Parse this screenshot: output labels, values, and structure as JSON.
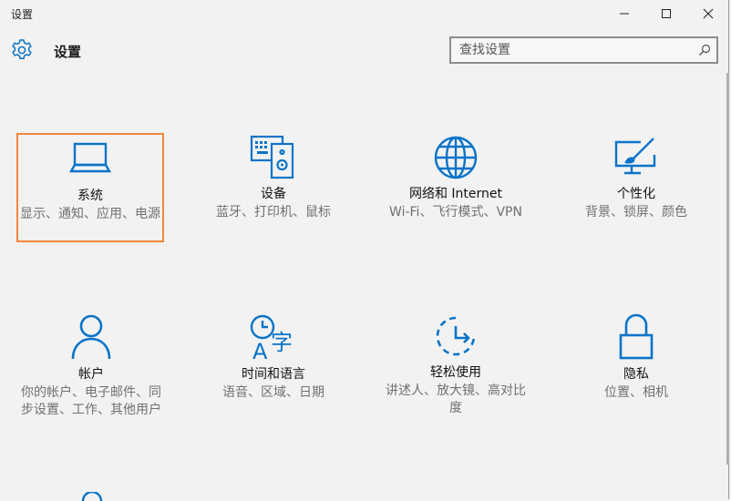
{
  "window": {
    "title": "设置"
  },
  "header": {
    "title": "设置"
  },
  "search": {
    "placeholder": "查找设置"
  },
  "accent": "#0a74c8",
  "selection_color": "#f0883a",
  "tiles": [
    {
      "id": "system",
      "icon": "laptop-icon",
      "label": "系统",
      "desc": "显示、通知、应用、电源"
    },
    {
      "id": "devices",
      "icon": "devices-icon",
      "label": "设备",
      "desc": "蓝牙、打印机、鼠标"
    },
    {
      "id": "network",
      "icon": "globe-icon",
      "label": "网络和 Internet",
      "desc": "Wi-Fi、飞行模式、VPN"
    },
    {
      "id": "personalization",
      "icon": "paintbrush-icon",
      "label": "个性化",
      "desc": "背景、锁屏、颜色"
    },
    {
      "id": "accounts",
      "icon": "person-icon",
      "label": "帐户",
      "desc": "你的帐户、电子邮件、同步设置、工作、其他用户"
    },
    {
      "id": "time",
      "icon": "time-language-icon",
      "label": "时间和语言",
      "desc": "语音、区域、日期"
    },
    {
      "id": "ease",
      "icon": "ease-of-access-icon",
      "label": "轻松使用",
      "desc": "讲述人、放大镜、高对比度"
    },
    {
      "id": "privacy",
      "icon": "lock-icon",
      "label": "隐私",
      "desc": "位置、相机"
    }
  ]
}
